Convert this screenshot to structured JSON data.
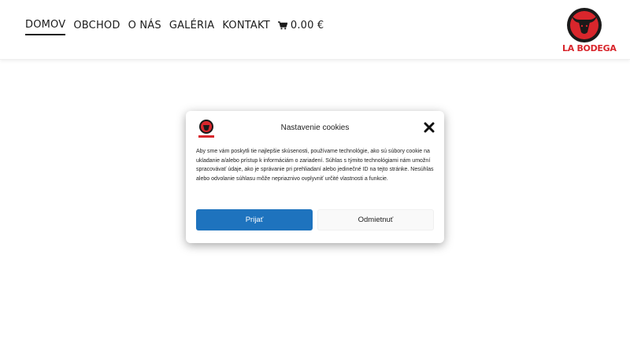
{
  "nav": {
    "items": [
      {
        "label": "DOMOV",
        "active": true
      },
      {
        "label": "OBCHOD",
        "active": false
      },
      {
        "label": "O NÁS",
        "active": false
      },
      {
        "label": "GALÉRIA",
        "active": false
      },
      {
        "label": "KONTAKT",
        "active": false
      }
    ],
    "cart_total": "0.00 €",
    "cart_icon": "shopping-cart-icon"
  },
  "logo": {
    "text": "LA BODEGA"
  },
  "cookie_dialog": {
    "title": "Nastavenie cookies",
    "body": "Aby sme vám poskytli tie najlepšie skúsenosti, používame technológie, ako sú súbory cookie na ukladanie a/alebo prístup k informáciám o zariadení. Súhlas s týmito technológiami nám umožní spracovávať údaje, ako je správanie pri prehliadaní alebo jedinečné ID na tejto stránke. Nesúhlas alebo odvolanie súhlasu môže nepriaznivo ovplyvniť určité vlastnosti a funkcie.",
    "accept_label": "Prijať",
    "deny_label": "Odmietnuť",
    "close_icon": "close-icon"
  },
  "colors": {
    "brand_red": "#d8262c",
    "accept_blue": "#1e73be"
  }
}
